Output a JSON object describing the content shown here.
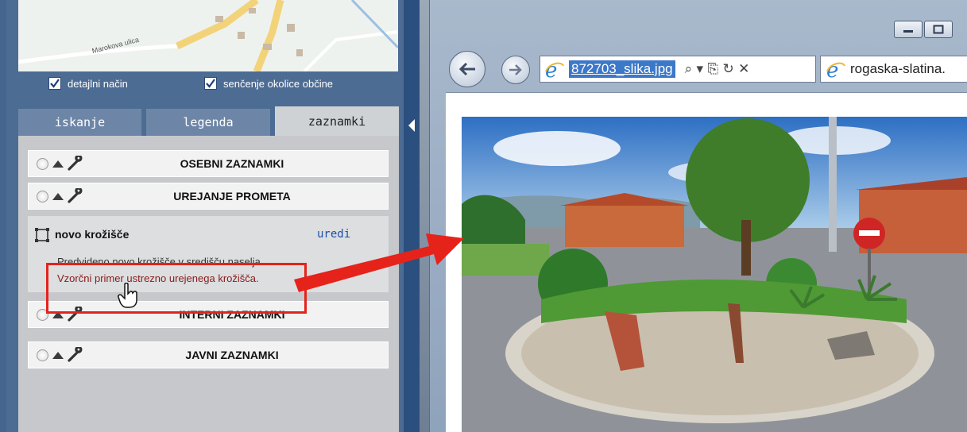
{
  "map": {
    "street_label": "Marokova ulica",
    "street_label2": "ulica"
  },
  "options": [
    {
      "label": "detajlni način",
      "checked": true
    },
    {
      "label": "senčenje okolice občine",
      "checked": true
    }
  ],
  "tabs": [
    {
      "label": "iskanje",
      "active": false
    },
    {
      "label": "legenda",
      "active": false
    },
    {
      "label": "zaznamki",
      "active": true
    }
  ],
  "groups": {
    "osebni": "OSEBNI ZAZNAMKI",
    "urejanje": "UREJANJE PROMETA",
    "interni": "INTERNI ZAZNAMKI",
    "javni": "JAVNI ZAZNAMKI"
  },
  "note": {
    "title": "novo krožišče",
    "edit": "uredi",
    "description": "Predvideno novo krožišče v središču naselja.",
    "link": "Vzorčni primer ustrezno urejenega krožišča."
  },
  "browser": {
    "url": "872703_slika.jpg",
    "tab_label": "rogaska-slatina.",
    "address_icons": "⌕ ▾ ⎘ ↻ ✕"
  },
  "colors": {
    "panel_blue": "#4d6c94",
    "highlight_red": "#e5231b",
    "link_red": "#8b1a1a",
    "edit_blue": "#1f4fa6"
  }
}
